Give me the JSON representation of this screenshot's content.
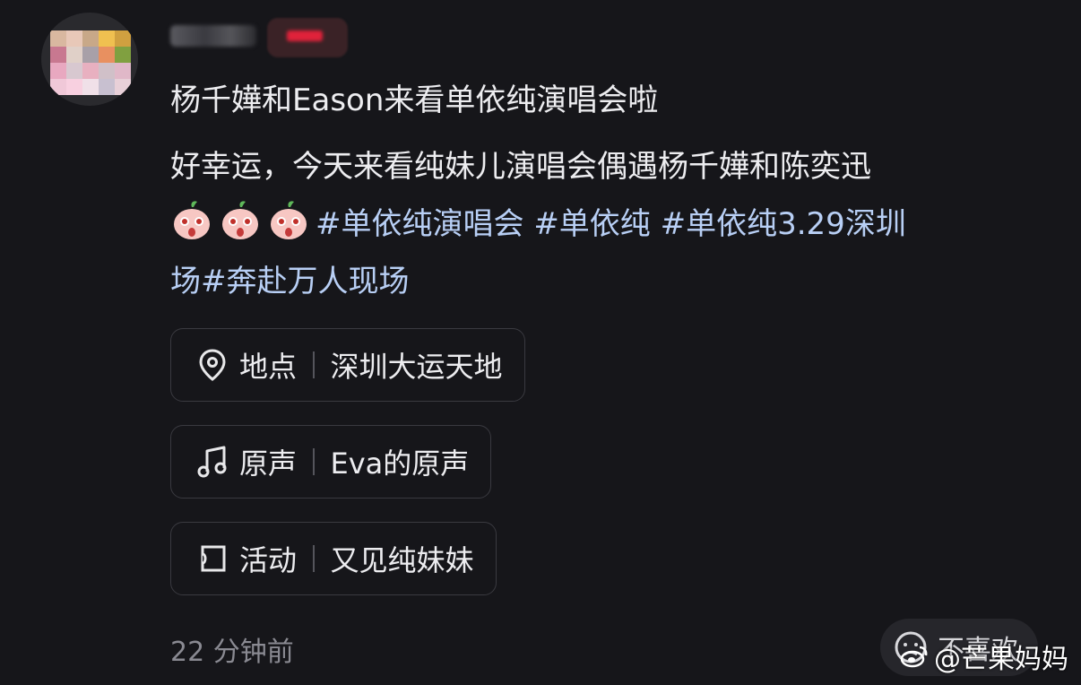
{
  "post": {
    "title": "杨千嬅和Eason来看单依纯演唱会啦",
    "line1": "好幸运，今天来看纯妹儿演唱会偶遇杨千嬅和陈奕迅",
    "hashtag1": "#单依纯演唱会",
    "hashtag2": "#单依纯",
    "hashtag3a": "#单依纯3.29深圳",
    "hashtag3b": "场#奔赴万人现场",
    "emoji_icon": "peach-shocked-emoji"
  },
  "chips": {
    "location": {
      "key": "地点",
      "value": "深圳大运天地",
      "icon": "location-pin-icon"
    },
    "sound": {
      "key": "原声",
      "value": "Eva的原声",
      "icon": "music-note-icon"
    },
    "activity": {
      "key": "活动",
      "value": "又见纯妹妹",
      "icon": "activity-icon"
    }
  },
  "meta": {
    "time": "22 分钟前"
  },
  "actions": {
    "dislike": "不喜欢"
  },
  "watermark": {
    "text": "@芒果妈妈",
    "icon": "weibo-icon"
  },
  "colors": {
    "background": "#16161a",
    "hashtag": "#b8cff5",
    "muted": "#8a8a92"
  }
}
